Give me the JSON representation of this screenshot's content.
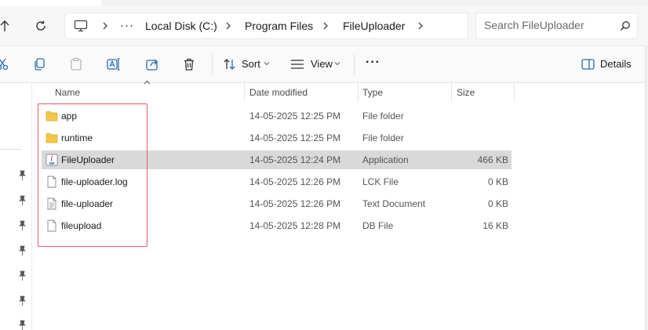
{
  "address": {
    "breadcrumbs": [
      "Local Disk (C:)",
      "Program Files",
      "FileUploader"
    ],
    "more_label": "···"
  },
  "search": {
    "placeholder": "Search FileUploader"
  },
  "toolbar": {
    "sort_label": "Sort",
    "view_label": "View",
    "more_label": "···",
    "details_label": "Details"
  },
  "columns": {
    "name": "Name",
    "date": "Date modified",
    "type": "Type",
    "size": "Size"
  },
  "files": [
    {
      "name": "app",
      "date": "14-05-2025 12:25 PM",
      "type": "File folder",
      "size": "",
      "icon": "folder-icon"
    },
    {
      "name": "runtime",
      "date": "14-05-2025 12:25 PM",
      "type": "File folder",
      "size": "",
      "icon": "folder-icon"
    },
    {
      "name": "FileUploader",
      "date": "14-05-2025 12:24 PM",
      "type": "Application",
      "size": "466 KB",
      "icon": "java-app-icon",
      "selected": true
    },
    {
      "name": "file-uploader.log",
      "date": "14-05-2025 12:26 PM",
      "type": "LCK File",
      "size": "0 KB",
      "icon": "file-icon"
    },
    {
      "name": "file-uploader",
      "date": "14-05-2025 12:26 PM",
      "type": "Text Document",
      "size": "0 KB",
      "icon": "text-file-icon"
    },
    {
      "name": "fileupload",
      "date": "14-05-2025 12:28 PM",
      "type": "DB File",
      "size": "16 KB",
      "icon": "file-icon"
    }
  ],
  "colors": {
    "selection": "#d9d9d9",
    "annotation_border": "#e05a5f",
    "folder_yellow": "#f7c948"
  }
}
